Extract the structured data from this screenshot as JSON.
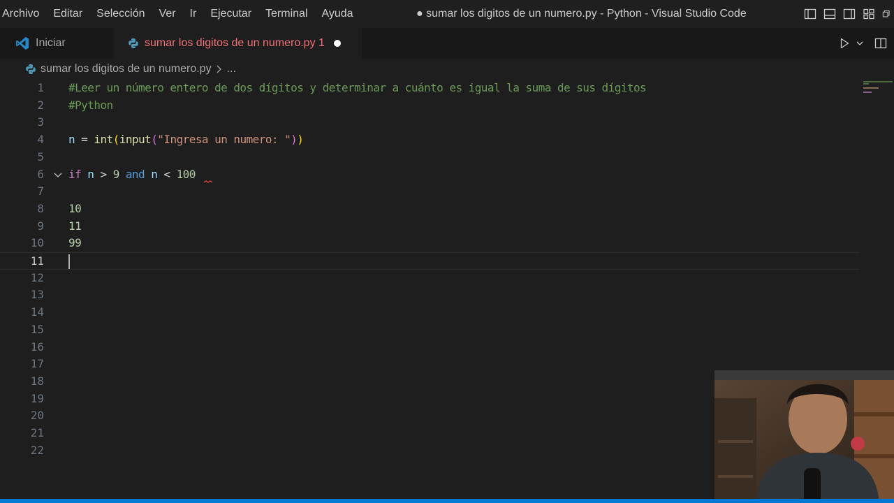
{
  "menu": [
    "Archivo",
    "Editar",
    "Selección",
    "Ver",
    "Ir",
    "Ejecutar",
    "Terminal",
    "Ayuda"
  ],
  "window_title": "● sumar los digitos de un numero.py - Python - Visual Studio Code",
  "tabs": {
    "start_label": "Iniciar",
    "active_label": "sumar los digitos de un numero.py 1"
  },
  "breadcrumb": {
    "file": "sumar los digitos de un numero.py",
    "more": "..."
  },
  "editor": {
    "line_numbers": [
      "1",
      "2",
      "3",
      "4",
      "5",
      "6",
      "7",
      "8",
      "9",
      "10",
      "11",
      "12",
      "13",
      "14",
      "15",
      "16",
      "17",
      "18",
      "19",
      "20",
      "21",
      "22"
    ],
    "current_line": "11",
    "code": {
      "l1": "#Leer un número entero de dos dígitos y determinar a cuánto es igual la suma de sus dígitos",
      "l2": "#Python",
      "l4_var": "n",
      "l4_eq": " = ",
      "l4_int": "int",
      "l4_p1": "(",
      "l4_input": "input",
      "l4_p2": "(",
      "l4_str": "\"Ingresa un numero: \"",
      "l4_p3": ")",
      "l4_p4": ")",
      "l6_if": "if",
      "l6_n1": " n ",
      "l6_gt": ">",
      "l6_9": " 9 ",
      "l6_and": "and",
      "l6_n2": " n ",
      "l6_lt": "<",
      "l6_100": " 100",
      "l8": "10",
      "l9": "11",
      "l10": "99"
    }
  },
  "colors": {
    "accent": "#0078d4",
    "comment": "#6a9955",
    "keyword": "#c586c0",
    "number": "#b5cea8",
    "string": "#ce9178",
    "function": "#dcdcaa",
    "variable": "#9cdcfe",
    "tab_error": "#f07178"
  },
  "icons": [
    "vscode-icon",
    "python-file-icon",
    "run-icon",
    "chevron-down-icon",
    "split-editor-icon",
    "fold-chevron-icon",
    "layout-icons"
  ]
}
